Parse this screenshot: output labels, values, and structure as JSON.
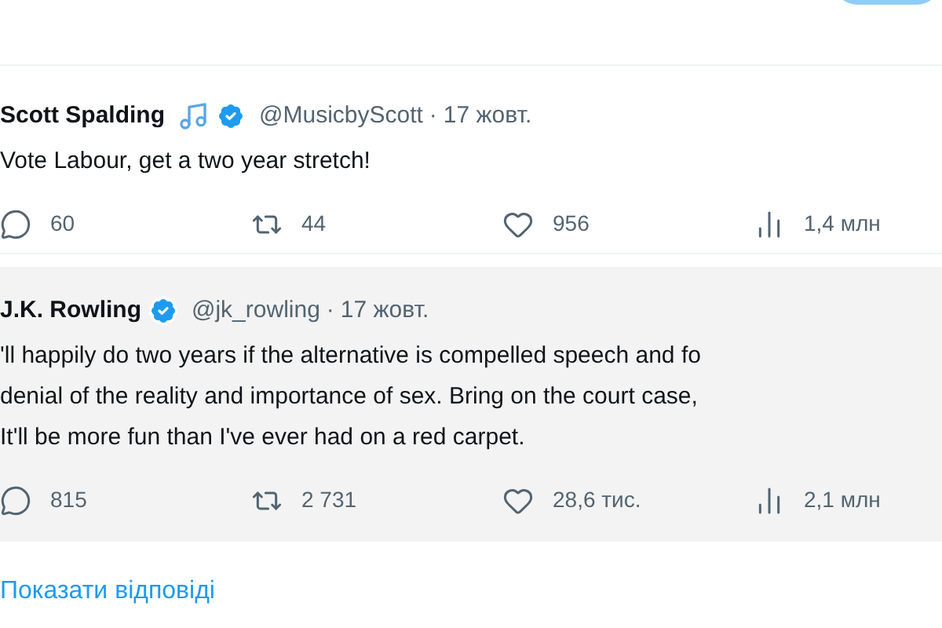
{
  "tweets": [
    {
      "name": "Scott Spalding",
      "name_emoji": true,
      "verified": true,
      "handle": "@MusicbyScott",
      "separator": "·",
      "date": "17 жовт.",
      "highlighted": false,
      "lines": [
        "Vote Labour, get a two year stretch!"
      ],
      "actions": [
        {
          "kind": "reply",
          "count": "60"
        },
        {
          "kind": "repost",
          "count": "44"
        },
        {
          "kind": "like",
          "count": "956"
        },
        {
          "kind": "views",
          "count": "1,4 млн"
        }
      ]
    },
    {
      "name": "J.K. Rowling",
      "name_emoji": false,
      "verified": true,
      "handle": "@jk_rowling",
      "separator": "·",
      "date": "17 жовт.",
      "highlighted": true,
      "lines": [
        "'ll happily do two years if the alternative is compelled speech and fo",
        "denial of the reality and importance of sex. Bring on the court case,",
        "It'll be more fun than I've ever had on a red carpet."
      ],
      "actions": [
        {
          "kind": "reply",
          "count": "815"
        },
        {
          "kind": "repost",
          "count": "2 731"
        },
        {
          "kind": "like",
          "count": "28,6 тис."
        },
        {
          "kind": "views",
          "count": "2,1 млн"
        }
      ]
    }
  ],
  "show_replies_link": "Показати відповіді"
}
